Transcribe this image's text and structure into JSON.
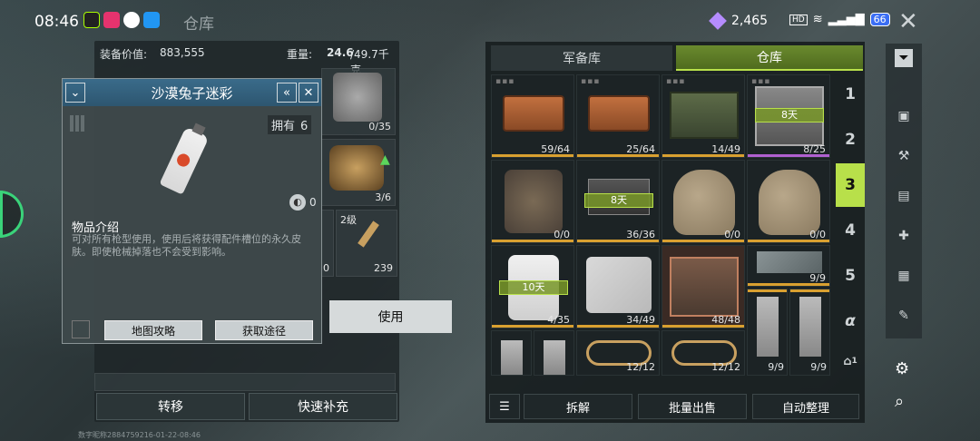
{
  "status": {
    "time": "08:46",
    "screen_title": "仓库",
    "gems": "2,465",
    "hd_label": "HD",
    "battery": "66"
  },
  "equip": {
    "value_label": "装备价值:",
    "value": "883,555",
    "weight_label": "重量:",
    "weight_current": "24.6",
    "weight_max": "/49.7千克",
    "slots": [
      {
        "count": "0/35"
      },
      {
        "count": "3/6"
      },
      {
        "level": "2级",
        "count": "239"
      },
      {
        "count": "0"
      }
    ],
    "transfer_label": "转移",
    "quick_refill_label": "快速补充"
  },
  "popup": {
    "title": "沙漠兔子迷彩",
    "own_label": "拥有",
    "own_count": "6",
    "badge_count": "0",
    "desc_title": "物品介绍",
    "desc_text": "可对所有枪型使用，使用后将获得配件槽位的永久皮肤。即使枪械掉落也不会受到影响。",
    "map_strategy_label": "地图攻略",
    "obtain_label": "获取途径"
  },
  "use_label": "使用",
  "tabs": {
    "armory": "军备库",
    "warehouse": "仓库"
  },
  "grid": [
    {
      "count": "59/64",
      "bar": "#d9a030"
    },
    {
      "count": "25/64",
      "bar": "#d9a030"
    },
    {
      "count": "14/49",
      "bar": "#d9a030"
    },
    {
      "count": "8/25",
      "bar": "#b060d0",
      "days": "8天"
    },
    {
      "count": "0/0",
      "bar": "#d9a030"
    },
    {
      "count": "36/36",
      "bar": "#d9a030",
      "days": "8天"
    },
    {
      "count": "0/0",
      "bar": "#d9a030"
    },
    {
      "count": "0/0",
      "bar": "#d9a030"
    },
    {
      "count": "4/35",
      "bar": "#d9a030",
      "days": "10天"
    },
    {
      "count": "34/49",
      "bar": "#d9a030"
    },
    {
      "count": "48/48",
      "bar": "#d9a030"
    },
    {
      "count": "9/9",
      "bar": "#d9a030"
    },
    {
      "count": "12/12",
      "bar": "#d9a030"
    },
    {
      "count": "12/12",
      "bar": "#d9a030"
    },
    {
      "count": "9/9",
      "bar": "#d9a030"
    },
    {
      "count": "9/9",
      "bar": "#d9a030"
    }
  ],
  "pages": [
    "1",
    "2",
    "3",
    "4",
    "5",
    "α"
  ],
  "active_page": "3",
  "warehouse_count": "1",
  "actions": {
    "dismantle": "拆解",
    "bulk_sell": "批量出售",
    "auto_sort": "自动整理"
  },
  "watermark": "数字昵称2884759216-01-22-08:46",
  "colors": {
    "accent_green": "#b8e04a",
    "tab_green": "#6a8a2e",
    "popup_blue": "#3a6b8a"
  }
}
